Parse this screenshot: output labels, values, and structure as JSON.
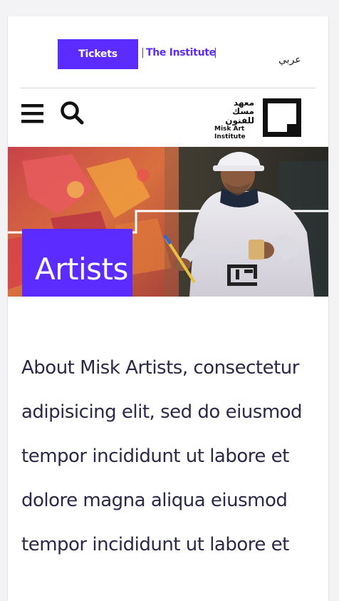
{
  "top_bar": {
    "tickets_label": "Tickets",
    "separator": "|",
    "institute_label": "The Institute",
    "language_label": "عربي"
  },
  "header": {
    "logo": {
      "arabic_line_1": "معهد",
      "arabic_line_2": "مسك للفنون",
      "english_line_1": "Misk Art",
      "english_line_2": "Institute"
    },
    "icons": {
      "menu": "hamburger-menu-icon",
      "search": "search-icon"
    }
  },
  "hero": {
    "title": "Artists",
    "image": "artist-painting-photo"
  },
  "main": {
    "intro_text": "About Misk Artists, consectetur adipisicing elit, sed do eiusmod tempor incididunt ut labore et dolore magna aliqua eiusmod tempor incididunt ut labore et"
  },
  "colors": {
    "accent": "#5b2bff",
    "text": "#2a2a48",
    "background": "#ffffff"
  }
}
